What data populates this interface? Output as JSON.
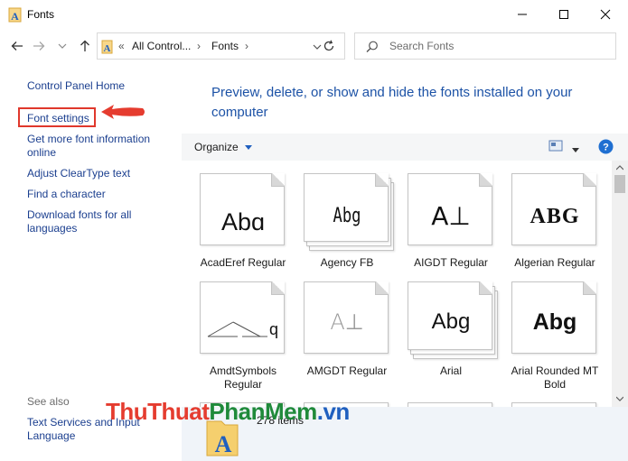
{
  "window": {
    "title": "Fonts",
    "controls": [
      "minimize",
      "maximize",
      "close"
    ]
  },
  "navigation": {
    "back_icon": "back-arrow-icon",
    "forward_icon": "forward-arrow-icon",
    "recent_icon": "chevron-down-icon",
    "up_icon": "up-arrow-icon",
    "address": {
      "overflow": "«",
      "segments": [
        "All Control...",
        "Fonts"
      ],
      "separator": "›"
    },
    "search": {
      "placeholder": "Search Fonts"
    }
  },
  "sidebar": {
    "items": [
      {
        "label": "Control Panel Home"
      },
      {
        "label": "Font settings",
        "highlighted": true
      },
      {
        "label": "Get more font information online"
      },
      {
        "label": "Adjust ClearType text"
      },
      {
        "label": "Find a character"
      },
      {
        "label": "Download fonts for all languages"
      }
    ],
    "see_also": {
      "heading": "See also",
      "items": [
        {
          "label": "Text Services and Input Language"
        }
      ]
    }
  },
  "main": {
    "header": "Preview, delete, or show and hide the fonts installed on your computer",
    "toolbar": {
      "organize_label": "Organize"
    },
    "fonts": [
      {
        "name": "AcadEref Regular",
        "preview": "Abɑ",
        "stacked": false
      },
      {
        "name": "Agency FB",
        "preview": "Abg",
        "stacked": true
      },
      {
        "name": "AIGDT Regular",
        "preview": "A⊥",
        "stacked": false
      },
      {
        "name": "Algerian Regular",
        "preview": "ABG",
        "stacked": false
      },
      {
        "name": "AmdtSymbols Regular",
        "preview": "q",
        "stacked": false
      },
      {
        "name": "AMGDT Regular",
        "preview": "A⊥",
        "stacked": false
      },
      {
        "name": "Arial",
        "preview": "Abg",
        "stacked": true
      },
      {
        "name": "Arial Rounded MT Bold",
        "preview": "Abg",
        "stacked": false
      }
    ],
    "item_count": "278 items"
  },
  "annotation": {
    "watermark": "ThuThuatPhanMem.vn",
    "colors": {
      "red": "#e53c2f",
      "green": "#1f8a3a",
      "blue": "#1f5fbf"
    }
  },
  "colors": {
    "link": "#1b3f8f",
    "header": "#1c52a6",
    "highlight_box": "#e0382c",
    "arrow": "#e53c2f"
  }
}
